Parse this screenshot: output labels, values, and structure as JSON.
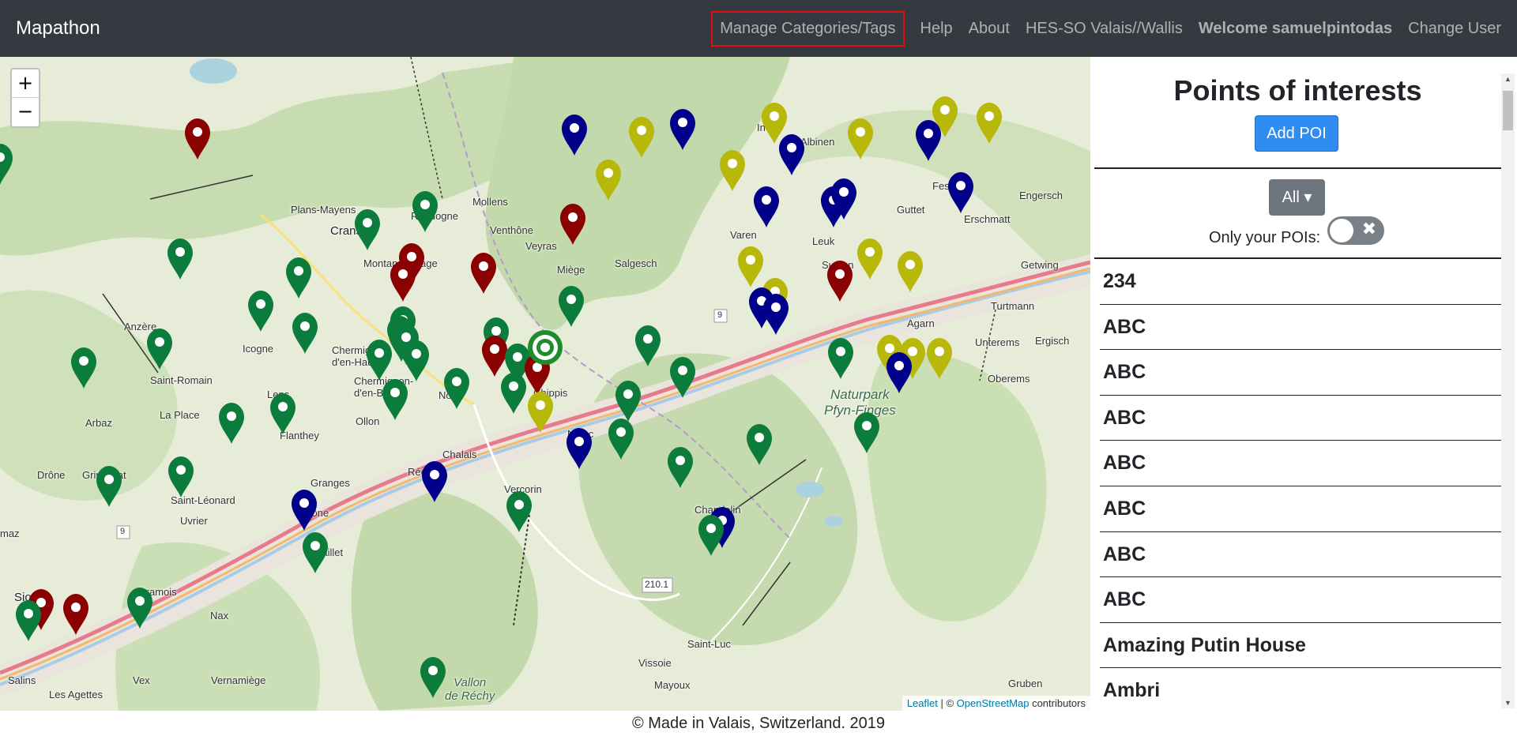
{
  "navbar": {
    "brand": "Mapathon",
    "links": [
      {
        "label": "Manage Categories/Tags"
      },
      {
        "label": "Help"
      },
      {
        "label": "About"
      },
      {
        "label": "HES-SO Valais//Wallis"
      },
      {
        "label": "Welcome samuelpintodas"
      },
      {
        "label": "Change User"
      }
    ]
  },
  "map": {
    "zoom_in": "+",
    "zoom_out": "−",
    "attribution": {
      "leaflet": "Leaflet",
      "sep": " | © ",
      "osm": "OpenStreetMap",
      "suffix": " contributors"
    },
    "places": {
      "mollens": "Mollens",
      "randogne": "Randogne",
      "plans_mayens": "Plans-Mayens",
      "crans": "Crans",
      "montana": "Montana-Village",
      "venthone": "Venthône",
      "veyras": "Veyras",
      "miege": "Miège",
      "salgesch": "Salgesch",
      "varen": "Varen",
      "leuk": "Leuk",
      "susten": "Susten",
      "inden": "Inden",
      "albinen": "Albinen",
      "feschel": "Feschel",
      "guttet": "Guttet",
      "erschmatt": "Erschmatt",
      "engersch": "Engersch",
      "getwing": "Getwing",
      "turtmann": "Turtmann",
      "unterems": "Unterems",
      "ergisch": "Ergisch",
      "oberems": "Oberems",
      "agarn": "Agarn",
      "anzere": "Anzère",
      "icogne": "Icogne",
      "chermignon_haut": "Chermignon-\nd'en-Haut",
      "chermignon_bas": "Chermignon-\nd'en-Bas",
      "noes": "Noës",
      "saint_romain": "Saint-Romain",
      "lens": "Lens",
      "la_place": "La Place",
      "arbaz": "Arbaz",
      "flanthey": "Flanthey",
      "ollon": "Ollon",
      "chippis": "Chippis",
      "niouc": "Niouc",
      "chalais": "Chalais",
      "rechy": "Réchy",
      "granges": "Granges",
      "grone": "Grône",
      "vercorin": "Vercorin",
      "chandolin": "Chandolin",
      "drone": "Drône",
      "grimisuat": "Grimisuat",
      "saint_leonard": "Saint-Léonard",
      "uvrier": "Uvrier",
      "sion": "Sion",
      "bramois": "Bramois",
      "daillet": "Daillet",
      "nax": "Nax",
      "vex": "Vex",
      "vernamiege": "Vernamiège",
      "salins": "Salins",
      "les_agettes": "Les Agettes",
      "saint_luc": "Saint-Luc",
      "vissoie": "Vissoie",
      "mayoux": "Mayoux",
      "gruben": "Gruben",
      "vallon_rechy": "Vallon\nde Réchy",
      "park": "Naturpark\nPfyn-Finges",
      "road_9a": "9",
      "road_9b": "9",
      "road_2101": "210.1",
      "maz": "maz"
    },
    "marker_colors": {
      "green": "#0c7c3c",
      "red": "#8b0000",
      "blue": "#00008b",
      "yellow": "#b8b80a"
    }
  },
  "sidebar": {
    "title": "Points of interests",
    "add_button": "Add POI",
    "filter_button": "All ▾",
    "only_yours_label": "Only your POIs:",
    "toggle_icon": "✖",
    "pois": [
      "234",
      "ABC",
      "ABC",
      "ABC",
      "ABC",
      "ABC",
      "ABC",
      "ABC",
      "Amazing Putin House",
      "Ambri"
    ]
  },
  "footer": {
    "text": "© Made in Valais, Switzerland. 2019"
  }
}
